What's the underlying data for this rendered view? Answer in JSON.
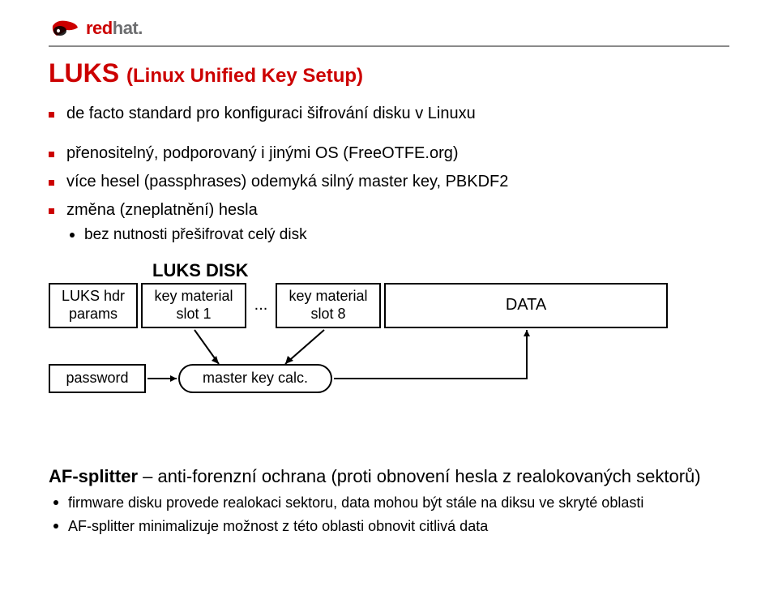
{
  "header": {
    "logo_red": "red",
    "logo_gray": "hat."
  },
  "title_main": "LUKS ",
  "title_sub": "(Linux Unified Key Setup)",
  "bullets": {
    "b1": "de facto standard pro konfiguraci šifrování disku v Linuxu",
    "b2": "přenositelný, podporovaný i jinými OS (FreeOTFE.org)",
    "b3": "více hesel (passphrases) odemyká silný master key, PBKDF2",
    "b4": "změna (zneplatnění) hesla",
    "b4s1": "bez nutnosti přešifrovat celý disk"
  },
  "diagram": {
    "luks_disk": "LUKS DISK",
    "hdr_l1": "LUKS hdr",
    "hdr_l2": "params",
    "slot1_l1": "key material",
    "slot1_l2": "slot 1",
    "ellipsis": "...",
    "slot8_l1": "key material",
    "slot8_l2": "slot 8",
    "data": "DATA",
    "password": "password",
    "mk_calc": "master key calc."
  },
  "af": {
    "head_bold": "AF-splitter",
    "head_rest": " – anti-forenzní ochrana (proti obnovení hesla z realokovaných sektorů)",
    "s1": "firmware disku provede realokaci sektoru, data mohou být stále na diksu ve skryté oblasti",
    "s2": "AF-splitter minimalizuje možnost z této oblasti obnovit citlivá data"
  }
}
